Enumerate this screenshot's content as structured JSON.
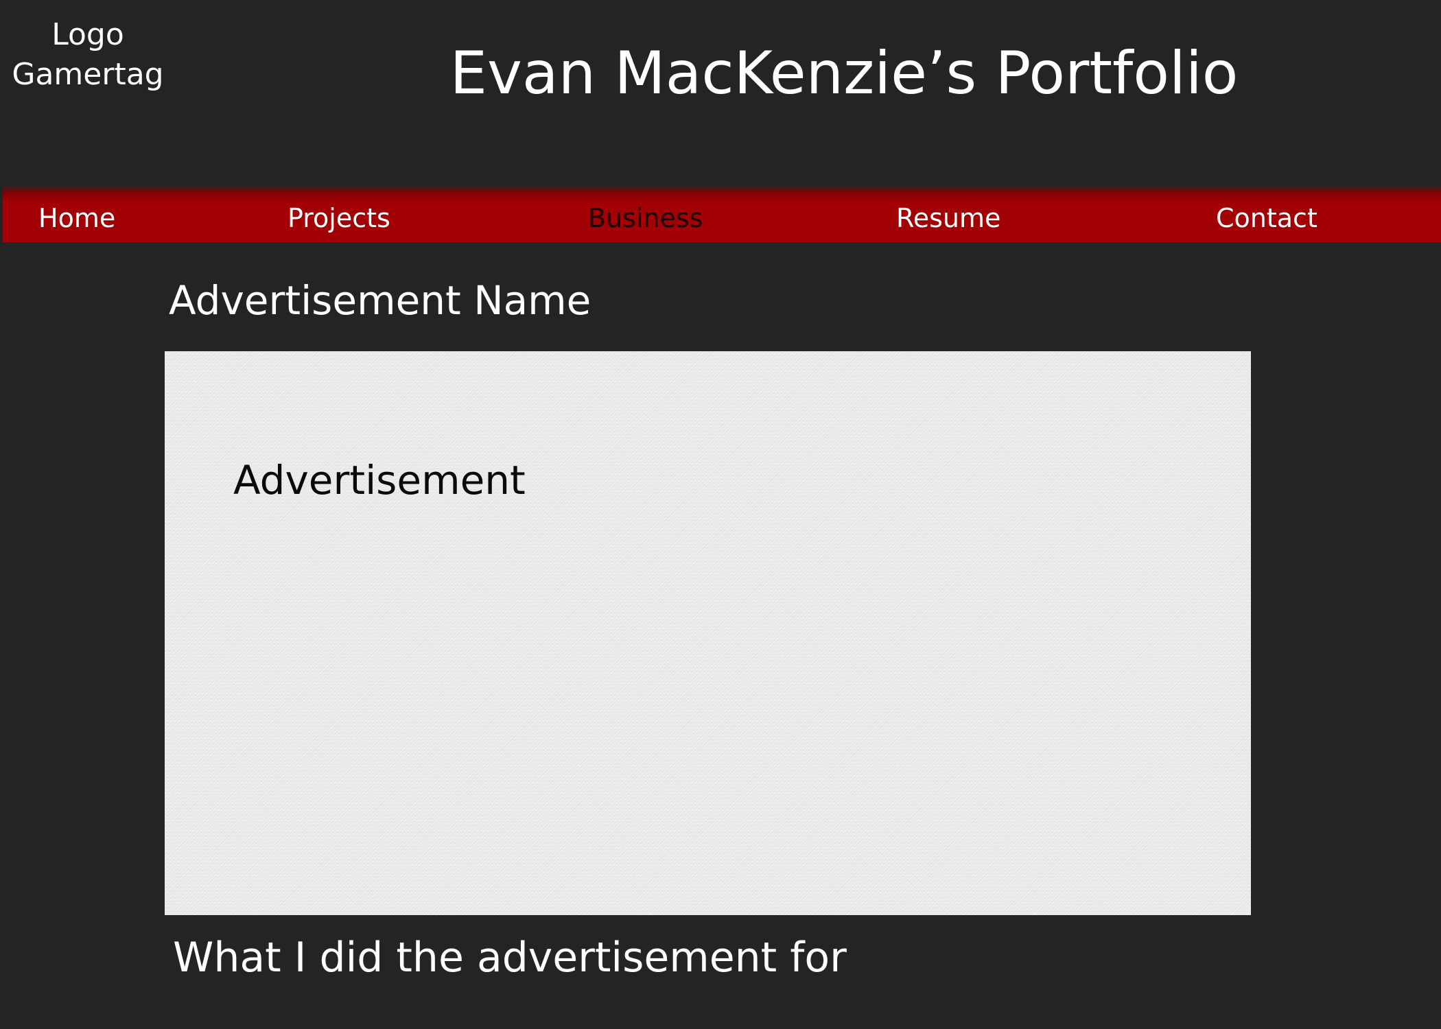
{
  "header": {
    "logo_line1": "Logo",
    "logo_line2": "Gamertag",
    "title": "Evan MacKenzie’s Portfolio"
  },
  "nav": {
    "items": [
      {
        "label": "Home"
      },
      {
        "label": "Projects"
      },
      {
        "label": "Business"
      },
      {
        "label": "Resume"
      },
      {
        "label": "Contact"
      }
    ],
    "active": "Business"
  },
  "main": {
    "ad_name": "Advertisement Name",
    "ad_label": "Advertisement",
    "ad_caption": "What I did the advertisement for"
  },
  "colors": {
    "background": "#242424",
    "nav_red": "#a20205",
    "nav_active_text": "#1c0001",
    "ad_box": "#ececec"
  }
}
